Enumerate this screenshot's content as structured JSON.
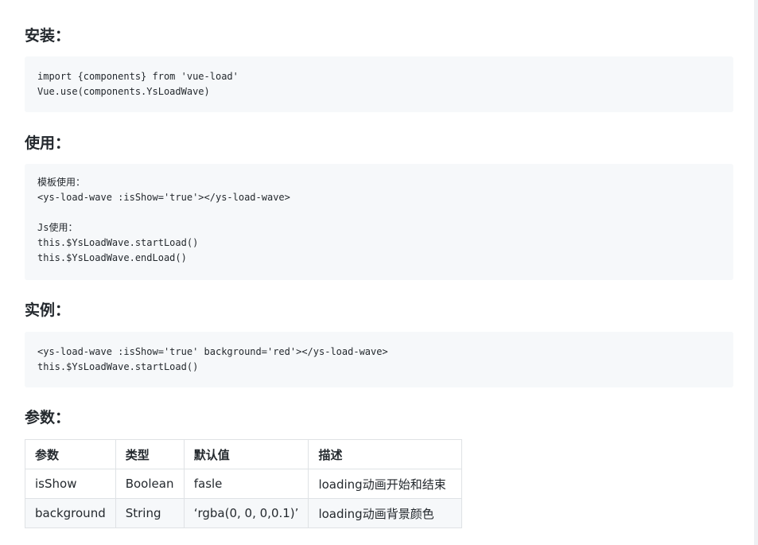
{
  "sections": {
    "install": {
      "heading": "安装：",
      "code": [
        "import {components} from 'vue-load'",
        "Vue.use(components.YsLoadWave)"
      ]
    },
    "usage": {
      "heading": "使用：",
      "code": [
        "模板使用：",
        "<ys-load-wave :isShow='true'></ys-load-wave>",
        "",
        "Js使用：",
        "this.$YsLoadWave.startLoad()",
        "this.$YsLoadWave.endLoad()"
      ]
    },
    "example": {
      "heading": "实例：",
      "code": [
        "<ys-load-wave :isShow='true' background='red'></ys-load-wave>",
        "this.$YsLoadWave.startLoad()"
      ]
    },
    "params": {
      "heading": "参数：",
      "table": {
        "headers": [
          "参数",
          "类型",
          "默认值",
          "描述"
        ],
        "rows": [
          [
            "isShow",
            "Boolean",
            "fasle",
            "loading动画开始和结束"
          ],
          [
            "background",
            "String",
            "‘rgba(0, 0, 0,0.1)’",
            "loading动画背景颜色"
          ]
        ]
      }
    }
  }
}
